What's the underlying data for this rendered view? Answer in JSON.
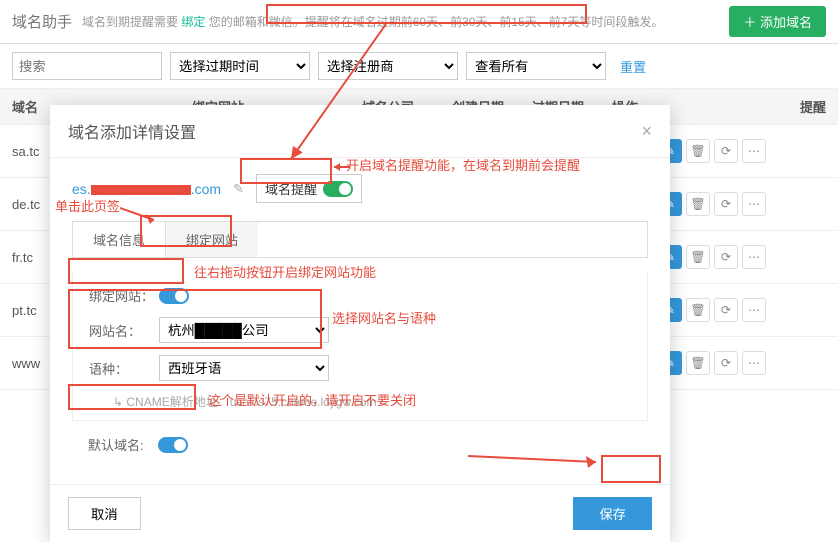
{
  "header": {
    "title": "域名助手",
    "text_pre": "域名到期提醒需要 ",
    "link": "绑定",
    "text_post": " 您的邮箱和微信。",
    "tip": "提醒将在域名过期前60天、前30天、前15天、前7天等时间段触发。",
    "add_btn": "＋ 添加域名"
  },
  "filters": {
    "search_placeholder": "搜索",
    "expire_select": "选择过期时间",
    "registrar_select": "选择注册商",
    "view_select": "查看所有",
    "reset": "重置"
  },
  "thead": {
    "domain": "域名",
    "bind": "绑定网站",
    "company": "域名公司",
    "created": "创建日期",
    "expire": "过期日期",
    "ops": "操作",
    "remind": "提醒"
  },
  "rows": [
    "sa.tc",
    "de.tc",
    "fr.tc",
    "pt.tc",
    "www"
  ],
  "modal": {
    "title": "域名添加详情设置",
    "domain_pre": "es.",
    "domain_suf": ".com",
    "remind_label": "域名提醒",
    "tab_info": "域名信息",
    "tab_bind": "绑定网站",
    "bind_label": "绑定网站：",
    "site_label": "网站名：",
    "site_value_pre": "杭州",
    "site_value_suf": "公司",
    "lang_label": "语种：",
    "lang_value": "西班牙语",
    "cname_label": "CNAME解析地址：",
    "cname_value": "usalos75.cname.ldygw.com",
    "default_label": "默认域名:",
    "cancel": "取消",
    "save": "保存"
  },
  "anno": {
    "a1": "开启域名提醒功能，在域名到期前会提醒",
    "a2": "单击此页签",
    "a3": "往右拖动按钮开启绑定网站功能",
    "a4": "选择网站名与语种",
    "a5": "这个是默认开启的，请开启不要关闭"
  }
}
